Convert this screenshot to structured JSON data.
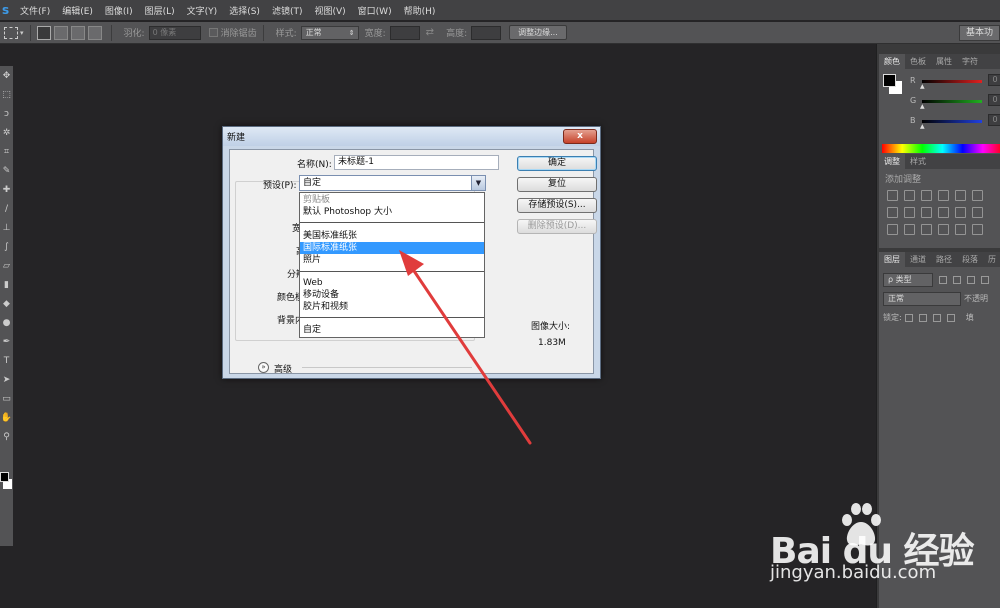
{
  "app": {
    "logo": "s"
  },
  "menu": [
    "文件(F)",
    "编辑(E)",
    "图像(I)",
    "图层(L)",
    "文字(Y)",
    "选择(S)",
    "滤镜(T)",
    "视图(V)",
    "窗口(W)",
    "帮助(H)"
  ],
  "options": {
    "feather_label": "羽化:",
    "feather_value": "0 像素",
    "antialias_label": "消除锯齿",
    "style_label": "样式:",
    "style_value": "正常",
    "width_label": "宽度:",
    "height_label": "高度:",
    "refine_button": "调整边缘...",
    "workspace": "基本功"
  },
  "right_panels": {
    "color_tabs": [
      "颜色",
      "色板",
      "属性",
      "字符"
    ],
    "channels": [
      {
        "label": "R",
        "value": "0",
        "color": "#e02020"
      },
      {
        "label": "G",
        "value": "0",
        "color": "#20b020"
      },
      {
        "label": "B",
        "value": "0",
        "color": "#2040e0"
      }
    ],
    "adjust_tabs": [
      "调整",
      "样式"
    ],
    "adjust_title": "添加调整",
    "layer_tabs": [
      "图层",
      "通道",
      "路径",
      "段落",
      "历"
    ],
    "layer_kind": "ρ 类型",
    "blend_mode": "正常",
    "opacity_label": "不透明",
    "lock_label": "锁定:",
    "fill_label": "填"
  },
  "dialog": {
    "title": "新建",
    "close": "x",
    "name_label": "名称(N):",
    "name_value": "未标题-1",
    "preset_label": "预设(P):",
    "preset_value": "自定",
    "partial_labels": [
      "宽",
      "高",
      "分辨",
      "颜色模",
      "背景内"
    ],
    "advanced_label": "高级",
    "image_size_label": "图像大小:",
    "image_size_value": "1.83M",
    "buttons": {
      "ok": "确定",
      "reset": "复位",
      "save_preset": "存储预设(S)...",
      "delete_preset": "删除预设(D)..."
    },
    "dropdown_options": [
      "剪贴板",
      "默认 Photoshop 大小",
      "美国标准纸张",
      "国际标准纸张",
      "照片",
      "Web",
      "移动设备",
      "胶片和视频",
      "自定"
    ],
    "selected_option": "国际标准纸张"
  },
  "watermark": {
    "line1": "Bai du 经验",
    "line2": "jingyan.baidu.com"
  },
  "colors": {
    "accent_select": "#3399ff",
    "arrow": "#e03c3c"
  }
}
